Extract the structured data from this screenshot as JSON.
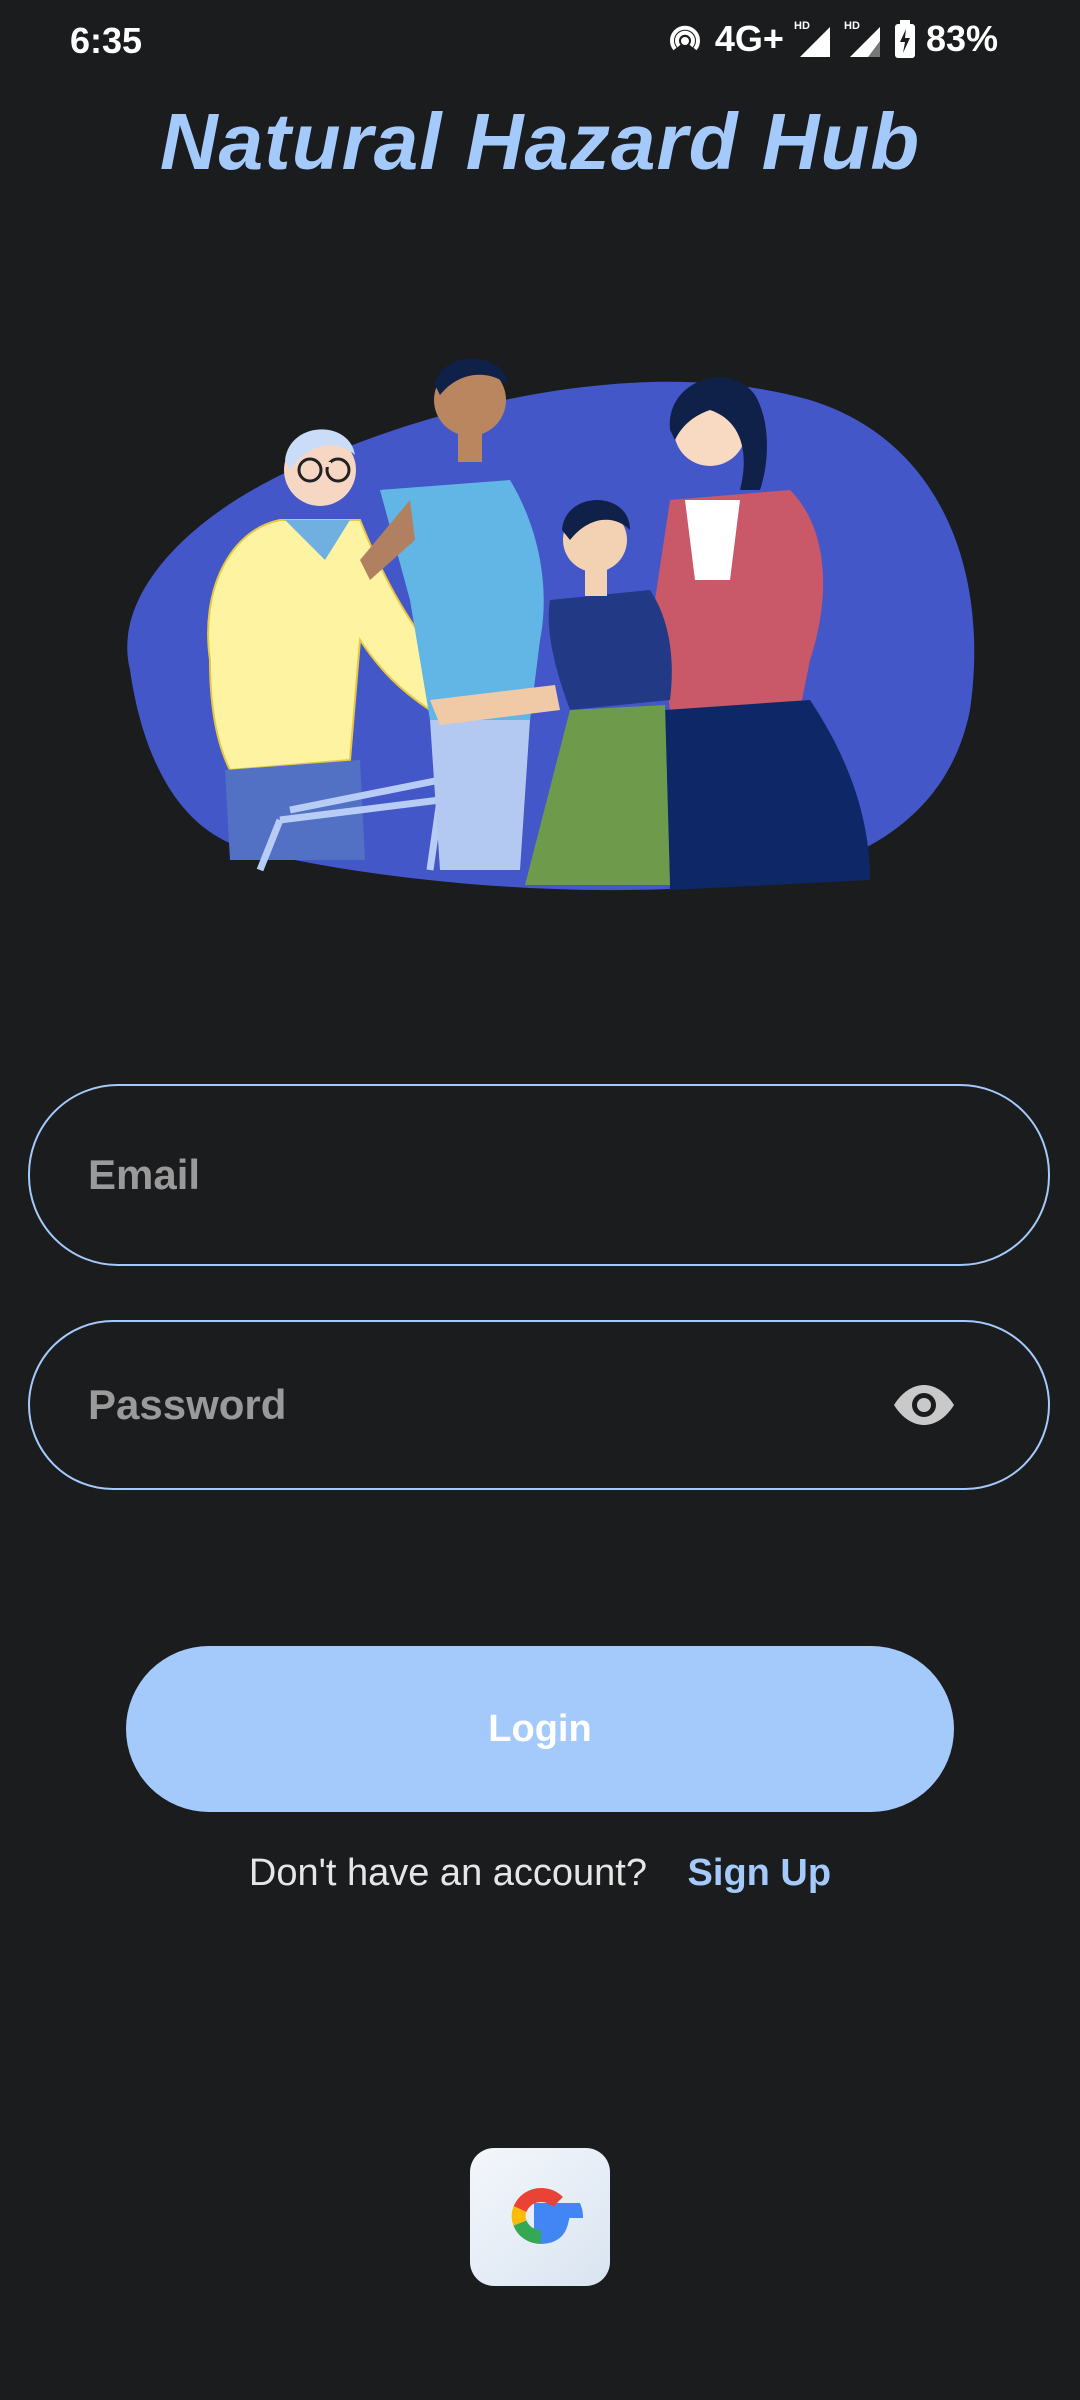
{
  "status_bar": {
    "time": "6:35",
    "network": "4G+",
    "battery": "83%",
    "icons": [
      "hotspot-icon",
      "signal-hd-icon",
      "signal-hd-icon",
      "battery-charging-icon"
    ]
  },
  "app": {
    "title": "Natural Hazard Hub"
  },
  "hero": {
    "icon": "family-illustration"
  },
  "form": {
    "email_placeholder": "Email",
    "password_placeholder": "Password",
    "password_toggle_icon": "eye-icon",
    "login_label": "Login"
  },
  "signup": {
    "prompt": "Don't have an account?",
    "link": "Sign Up"
  },
  "social": {
    "google_icon": "google-icon"
  },
  "colors": {
    "background": "#1b1c1e",
    "accent": "#a4c9fb",
    "blob": "#4457c8"
  }
}
